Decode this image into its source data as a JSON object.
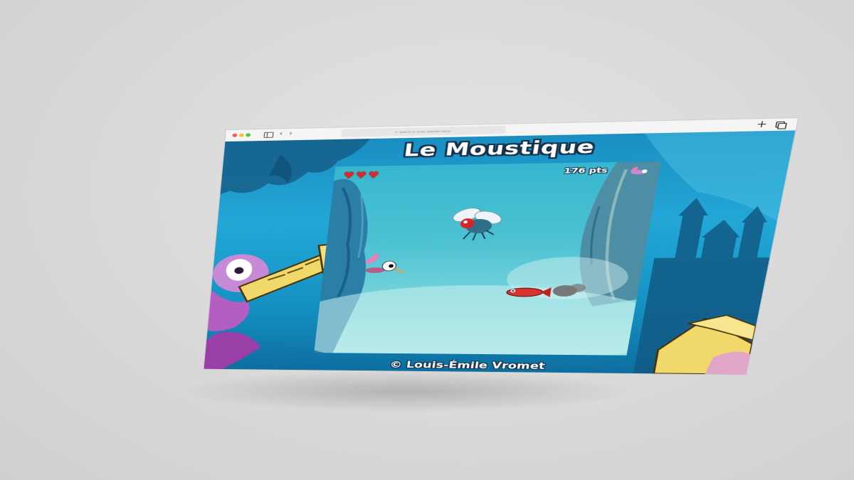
{
  "browser": {
    "address_placeholder": "Search or enter website name",
    "back_glyph": "‹",
    "forward_glyph": "›",
    "new_tab_glyph": "+"
  },
  "page": {
    "title": "Le Moustique",
    "credit": "© Louis-Émile Vromet"
  },
  "game": {
    "lives": 3,
    "score_text": "176 pts",
    "heart_glyph": "♥",
    "characters": [
      "mosquito-player",
      "fly-enemy",
      "red-fish-enemy",
      "mosquito-icon-hud"
    ]
  },
  "colors": {
    "traffic_red": "#f25c55",
    "traffic_yellow": "#f6be3b",
    "traffic_green": "#3fcb4a",
    "heart": "#d62b2b",
    "title_outline": "#15314a"
  }
}
